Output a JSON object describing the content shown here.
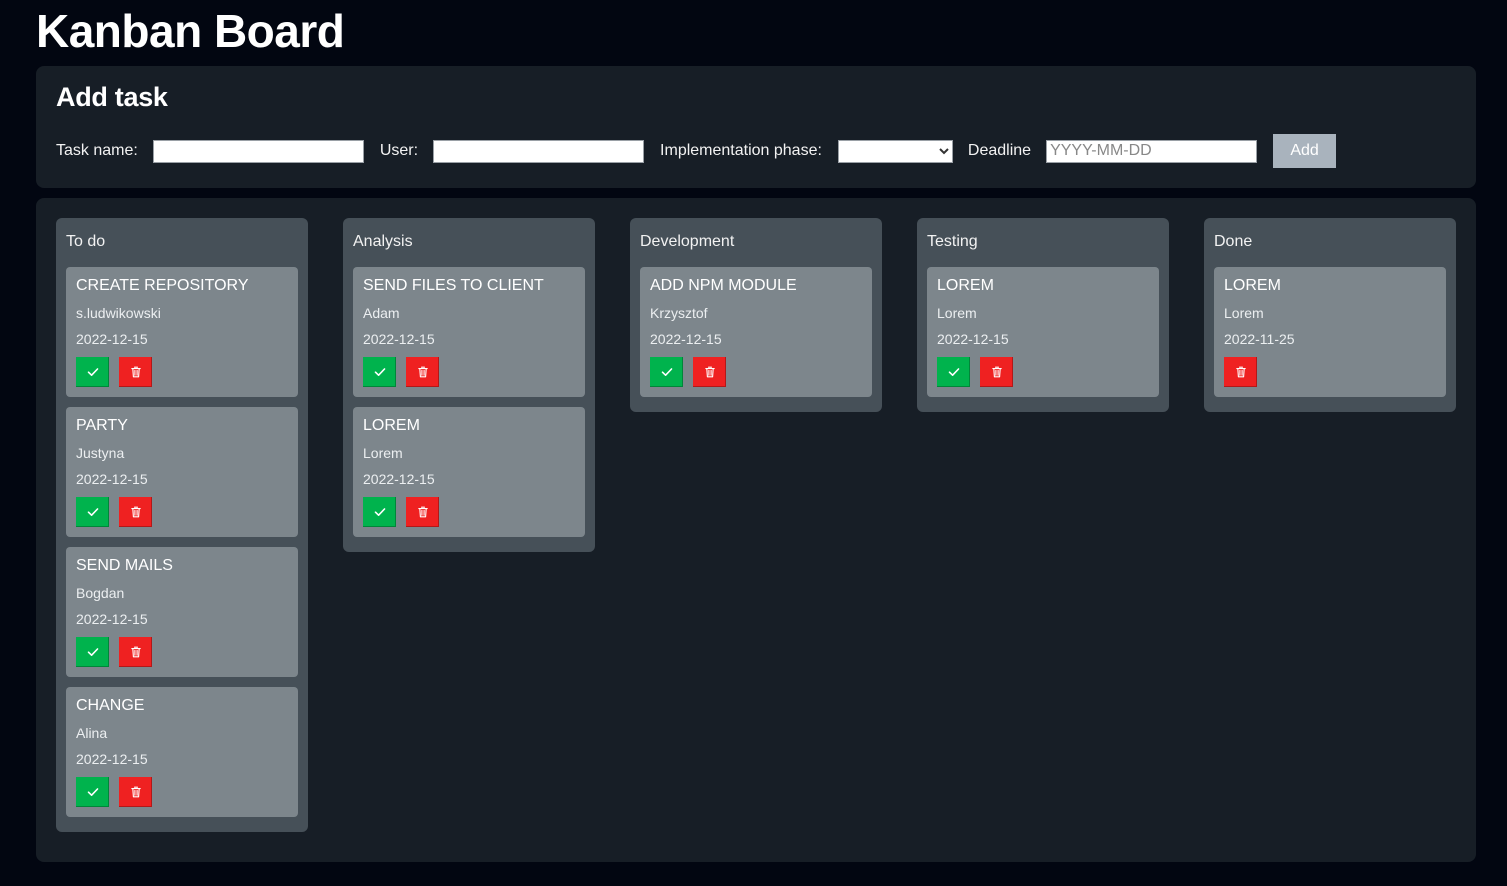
{
  "app": {
    "title": "Kanban Board"
  },
  "add_task": {
    "heading": "Add task",
    "task_name_label": "Task name:",
    "task_name_value": "",
    "user_label": "User:",
    "user_value": "",
    "phase_label": "Implementation phase:",
    "phase_selected": "",
    "deadline_label": "Deadline",
    "deadline_placeholder": "YYYY-MM-DD",
    "add_button_label": "Add"
  },
  "colors": {
    "background": "#020611",
    "panel": "#171e26",
    "column": "#465058",
    "card": "#7d868c",
    "done_button": "#00b34d",
    "delete_button": "#ef2121",
    "add_button": "#a9b3bd"
  },
  "icons": {
    "done": "check-icon",
    "delete": "trash-icon"
  },
  "columns": [
    {
      "title": "To do",
      "cards": [
        {
          "title": "CREATE REPOSITORY",
          "user": "s.ludwikowski",
          "date": "2022-12-15",
          "can_advance": true
        },
        {
          "title": "PARTY",
          "user": "Justyna",
          "date": "2022-12-15",
          "can_advance": true
        },
        {
          "title": "SEND MAILS",
          "user": "Bogdan",
          "date": "2022-12-15",
          "can_advance": true
        },
        {
          "title": "CHANGE",
          "user": "Alina",
          "date": "2022-12-15",
          "can_advance": true
        }
      ]
    },
    {
      "title": "Analysis",
      "cards": [
        {
          "title": "SEND FILES TO CLIENT",
          "user": "Adam",
          "date": "2022-12-15",
          "can_advance": true
        },
        {
          "title": "LOREM",
          "user": "Lorem",
          "date": "2022-12-15",
          "can_advance": true
        }
      ]
    },
    {
      "title": "Development",
      "cards": [
        {
          "title": "ADD NPM MODULE",
          "user": "Krzysztof",
          "date": "2022-12-15",
          "can_advance": true
        }
      ]
    },
    {
      "title": "Testing",
      "cards": [
        {
          "title": "LOREM",
          "user": "Lorem",
          "date": "2022-12-15",
          "can_advance": true
        }
      ]
    },
    {
      "title": "Done",
      "cards": [
        {
          "title": "LOREM",
          "user": "Lorem",
          "date": "2022-11-25",
          "can_advance": false
        }
      ]
    }
  ]
}
